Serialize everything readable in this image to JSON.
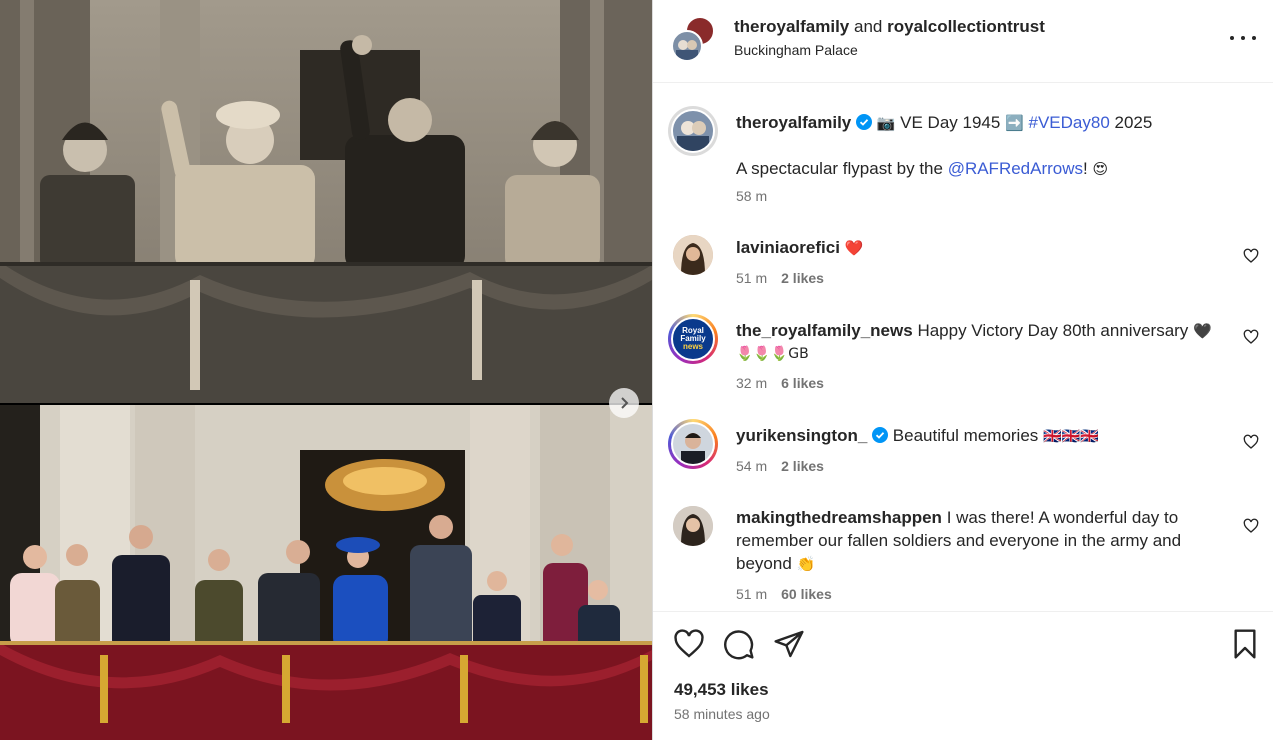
{
  "post": {
    "authors": {
      "first": "theroyalfamily",
      "and": "and",
      "second": "royalcollectiontrust"
    },
    "location": "Buckingham Palace",
    "caption": {
      "username": "theroyalfamily",
      "camera": "📷",
      "text1": "VE Day 1945",
      "arrow": "➡️",
      "hashtag": "#VEDay80",
      "text2": "2025",
      "line2_pre": "A spectacular flypast by the",
      "mention": "@RAFRedArrows",
      "line2_post": "!",
      "emoji": "😍",
      "time": "58 m"
    },
    "likes_count": "49,453 likes",
    "time_ago": "58 minutes ago"
  },
  "comments": [
    {
      "username": "laviniaorefici",
      "text": "",
      "emoji": "❤️",
      "time": "51 m",
      "likes": "2 likes"
    },
    {
      "username": "the_royalfamily_news",
      "text": "Happy Victory Day 80th anniversary",
      "emoji": "🖤",
      "line2": "🌷🌷🌷GB",
      "time": "32 m",
      "likes": "6 likes"
    },
    {
      "username": "yurikensington_",
      "text": "Beautiful memories",
      "emoji": "🇬🇧🇬🇧🇬🇧",
      "time": "54 m",
      "likes": "2 likes"
    },
    {
      "username": "makingthedreamshappen",
      "text": "I was there! A wonderful day to remember our fallen soldiers and everyone in the army and beyond",
      "emoji": "👏",
      "time": "51 m",
      "likes": "60 likes"
    }
  ],
  "news_avatar": {
    "line1": "Royal",
    "line2": "Family",
    "line3": "news"
  },
  "icons": [
    "more-icon",
    "verified-icon",
    "heart-icon",
    "comment-icon",
    "share-icon",
    "bookmark-icon",
    "chevron-right-icon"
  ],
  "colors": {
    "link": "#3b5cd4",
    "verified": "#0095f6",
    "muted": "#737373",
    "text": "#262626",
    "balcony_red": "#7b1420"
  }
}
